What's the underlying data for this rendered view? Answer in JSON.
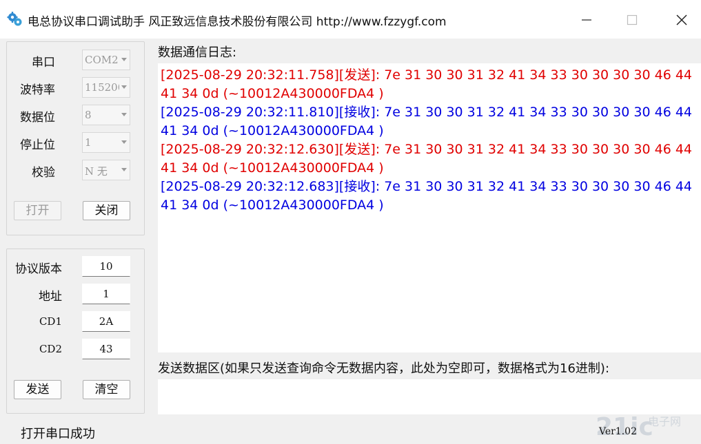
{
  "window": {
    "title": "电总协议串口调试助手 风正致远信息技术股份有限公司 http://www.fzzygf.com"
  },
  "serial": {
    "port_label": "串口",
    "port_value": "COM2",
    "baud_label": "波特率",
    "baud_value": "115200",
    "databits_label": "数据位",
    "databits_value": "8",
    "stopbits_label": "停止位",
    "stopbits_value": "1",
    "parity_label": "校验",
    "parity_value": "N 无",
    "open_label": "打开",
    "close_label": "关闭"
  },
  "protocol": {
    "version_label": "协议版本",
    "version_value": "10",
    "address_label": "地址",
    "address_value": "1",
    "cd1_label": "CD1",
    "cd1_value": "2A",
    "cd2_label": "CD2",
    "cd2_value": "43",
    "send_label": "发送",
    "clear_label": "清空"
  },
  "log": {
    "title": "数据通信日志:",
    "entries": [
      {
        "text": "[2025-08-29 20:32:11.758][发送]: 7e 31 30 30 31 32 41 34 33 30 30 30 30 46 44 41 34 0d (~10012A430000FDA4 )",
        "color": "#e00000"
      },
      {
        "text": "[2025-08-29 20:32:11.810][接收]: 7e 31 30 30 31 32 41 34 33 30 30 30 30 46 44 41 34 0d (~10012A430000FDA4 )",
        "color": "#0000e0"
      },
      {
        "text": "[2025-08-29 20:32:12.630][发送]: 7e 31 30 30 31 32 41 34 33 30 30 30 30 46 44 41 34 0d (~10012A430000FDA4 )",
        "color": "#e00000"
      },
      {
        "text": "[2025-08-29 20:32:12.683][接收]: 7e 31 30 30 31 32 41 34 33 30 30 30 30 46 44 41 34 0d (~10012A430000FDA4 )",
        "color": "#0000e0"
      }
    ]
  },
  "send": {
    "title": "发送数据区(如果只发送查询命令无数据内容，此处为空即可，数据格式为16进制):",
    "value": ""
  },
  "status": {
    "text": "打开串口成功",
    "version": "Ver1.02"
  },
  "watermark": {
    "text": "21ic 电子网"
  },
  "icons": [
    "app-gears-icon",
    "minimize-icon",
    "maximize-icon",
    "close-icon"
  ]
}
